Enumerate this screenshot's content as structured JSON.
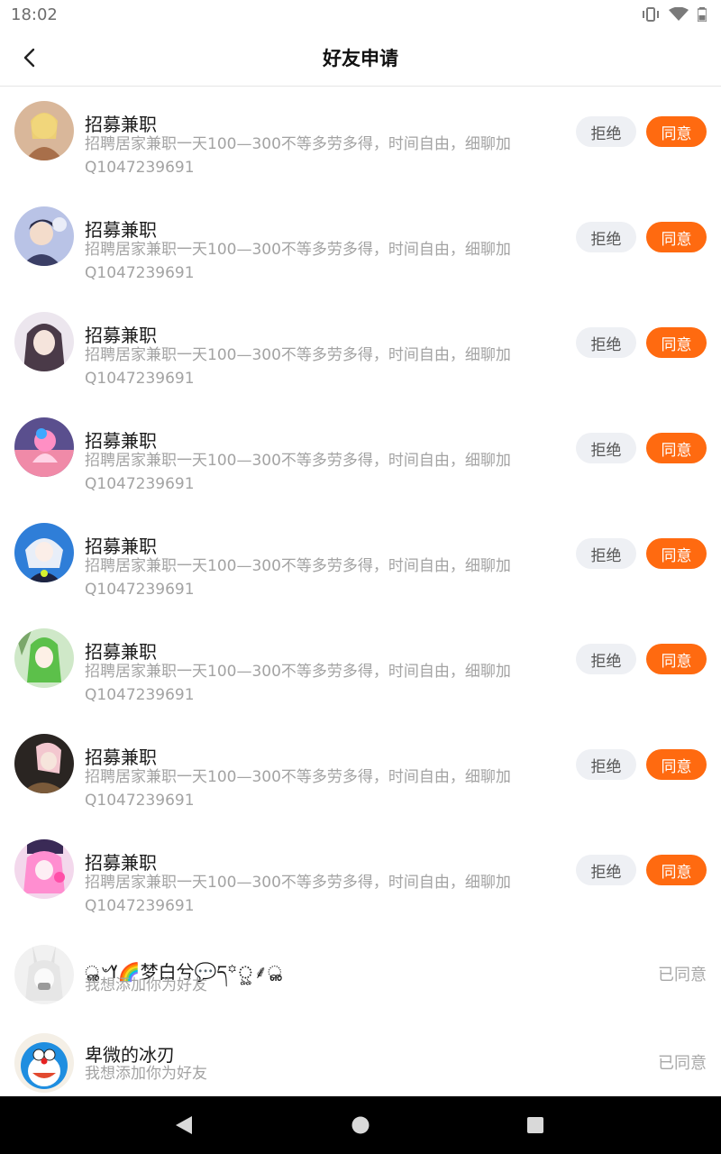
{
  "status_bar": {
    "time": "18:02"
  },
  "header": {
    "title": "好友申请"
  },
  "requests": [
    {
      "name": "招募兼职",
      "message": "招聘居家兼职一天100—300不等多劳多得，时间自由，细聊加Q1047239691",
      "reject_label": "拒绝",
      "accept_label": "同意"
    },
    {
      "name": "招募兼职",
      "message": "招聘居家兼职一天100—300不等多劳多得，时间自由，细聊加Q1047239691",
      "reject_label": "拒绝",
      "accept_label": "同意"
    },
    {
      "name": "招募兼职",
      "message": "招聘居家兼职一天100—300不等多劳多得，时间自由，细聊加Q1047239691",
      "reject_label": "拒绝",
      "accept_label": "同意"
    },
    {
      "name": "招募兼职",
      "message": "招聘居家兼职一天100—300不等多劳多得，时间自由，细聊加Q1047239691",
      "reject_label": "拒绝",
      "accept_label": "同意"
    },
    {
      "name": "招募兼职",
      "message": "招聘居家兼职一天100—300不等多劳多得，时间自由，细聊加Q1047239691",
      "reject_label": "拒绝",
      "accept_label": "同意"
    },
    {
      "name": "招募兼职",
      "message": "招聘居家兼职一天100—300不等多劳多得，时间自由，细聊加Q1047239691",
      "reject_label": "拒绝",
      "accept_label": "同意"
    },
    {
      "name": "招募兼职",
      "message": "招聘居家兼职一天100—300不等多劳多得，时间自由，细聊加Q1047239691",
      "reject_label": "拒绝",
      "accept_label": "同意"
    },
    {
      "name": "招募兼职",
      "message": "招聘居家兼职一天100—300不等多劳多得，时间自由，细聊加Q1047239691",
      "reject_label": "拒绝",
      "accept_label": "同意"
    }
  ],
  "accepted": [
    {
      "name": "ൢ৺ߌ🌈梦白兮💬ད꙳ৣ⸙ൢ",
      "message": "我想添加你为好友",
      "status": "已同意"
    },
    {
      "name": "卑微的冰刃",
      "message": "我想添加你为好友",
      "status": "已同意"
    }
  ],
  "colors": {
    "accent": "#ff6a10",
    "reject_bg": "#eef0f4",
    "muted_text": "#a3a3a3"
  }
}
